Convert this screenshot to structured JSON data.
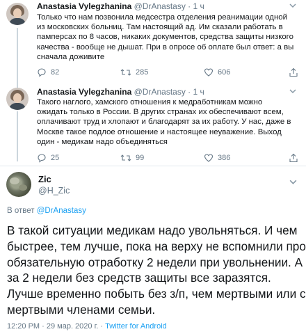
{
  "thread": [
    {
      "author_name": "Anastasia Vylegzhanina",
      "handle": "@DrAnastasy",
      "time": "1 ч",
      "separator": "·",
      "lines": [
        "Только что нам позвонила медсестра отделения реанимации одной",
        "из московских больниц. Там настоящий ад. Им сказали работать в",
        "памперсах по 8 часов, никаких документов, средства защиты низкого",
        "качества - вообще не дышат. При в опросе об оплате был ответ: а вы",
        "сначала доживите"
      ],
      "replies": "82",
      "retweets": "285",
      "likes": "606"
    },
    {
      "author_name": "Anastasia Vylegzhanina",
      "handle": "@DrAnastasy",
      "time": "1 ч",
      "separator": "·",
      "lines": [
        "Такого наглого, хамского отношения к медработникам можно",
        "ожидать только в России. В других странах их обеспечивают всем,",
        "оплачивают труд и хлопают и благодарят за их работу. У нас, даже в",
        "Москве такое подлое отношение и настоящее неуважение. Выход",
        "один - медикам надо объединяться"
      ],
      "replies": "25",
      "retweets": "99",
      "likes": "386"
    }
  ],
  "focused": {
    "author_name": "Zic",
    "handle": "@H_Zic",
    "reply_prefix": "В ответ",
    "reply_to": "@DrAnastasy",
    "lines": [
      "В такой ситуации медикам надо увольняться. И чем",
      "быстрее, тем лучше, пока на верху не вспомнили про",
      "обязательную отработку 2 недели при увольнении. А",
      "за 2 недели без средств защиты все заразятся.",
      "Лучше временно побыть без з/п, чем мертвыми или с",
      "мертвыми членами семьи."
    ],
    "timestamp": "12:20 PM · 29 мар. 2020 г. ·",
    "source": "Twitter for Android"
  },
  "icons": {
    "reply": "reply-icon",
    "retweet": "retweet-icon",
    "like": "heart-icon",
    "share": "share-icon",
    "menu": "chevron-down-icon"
  },
  "colors": {
    "text": "#14171a",
    "secondary": "#657786",
    "link": "#1da1f2",
    "divider": "#e1e8ed",
    "thread_line": "#ccd6dd"
  }
}
